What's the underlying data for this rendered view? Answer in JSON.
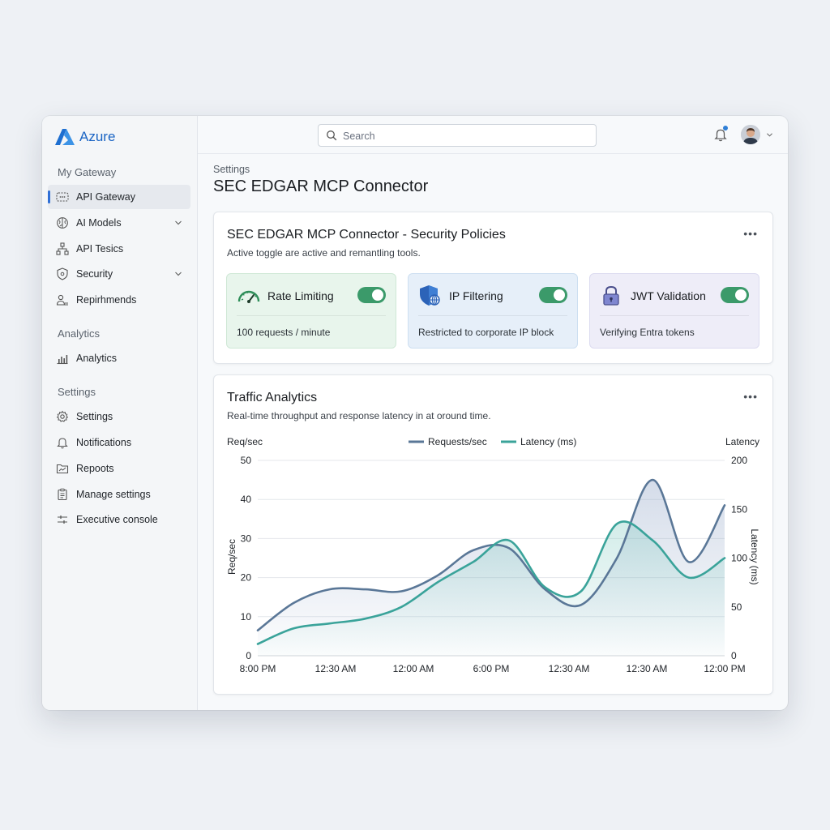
{
  "app": {
    "brand": "Azure"
  },
  "sidebar": {
    "sections": [
      {
        "label": "My Gateway"
      },
      {
        "label": "Analytics"
      },
      {
        "label": "Settings"
      }
    ],
    "items": [
      {
        "label": "API Gateway",
        "icon": "api-gateway-icon",
        "active": true
      },
      {
        "label": "AI Models",
        "icon": "brain-icon",
        "chevron": true
      },
      {
        "label": "API Tesics",
        "icon": "hierarchy-icon"
      },
      {
        "label": "Security",
        "icon": "shield-icon",
        "chevron": true
      },
      {
        "label": "Repirhmends",
        "icon": "user-list-icon"
      },
      {
        "label": "Analytics",
        "icon": "bar-chart-icon"
      },
      {
        "label": "Settings",
        "icon": "gear-icon"
      },
      {
        "label": "Notifications",
        "icon": "bell-icon"
      },
      {
        "label": "Repoots",
        "icon": "folder-chart-icon"
      },
      {
        "label": "Manage settings",
        "icon": "clipboard-icon"
      },
      {
        "label": "Executive console",
        "icon": "sliders-icon"
      }
    ]
  },
  "topbar": {
    "search_placeholder": "Search"
  },
  "page": {
    "breadcrumb": "Settings",
    "title": "SEC EDGAR MCP Connector"
  },
  "policies_card": {
    "title": "SEC EDGAR MCP Connector - Security Policies",
    "subtitle": "Active toggle are active and remantling tools.",
    "more": "•••",
    "policies": [
      {
        "name": "Rate Limiting",
        "desc": "100 requests / minute",
        "icon": "speedometer-icon",
        "enabled": true,
        "bg": "#e8f5ec",
        "border": "#cfe8d6"
      },
      {
        "name": "IP Filtering",
        "desc": "Restricted to corporate IP block",
        "icon": "shield-globe-icon",
        "enabled": true,
        "bg": "#e6eff9",
        "border": "#cddff1"
      },
      {
        "name": "JWT Validation",
        "desc": "Verifying Entra tokens",
        "icon": "lock-icon",
        "enabled": true,
        "bg": "#eeedf8",
        "border": "#dcdbf0"
      }
    ],
    "toggle_color": "#3b9a6a"
  },
  "traffic_card": {
    "title": "Traffic Analytics",
    "subtitle": "Real-time throughput and response latency in at oround time.",
    "more": "•••"
  },
  "chart_data": {
    "type": "line",
    "x": [
      "8:00 PM",
      "12:30 AM",
      "12:00 AM",
      "6:00 PM",
      "12:30 AM",
      "12:30 AM",
      "12:00 PM"
    ],
    "series": [
      {
        "name": "Requests/sec",
        "axis": "left",
        "color": "#5a7797",
        "values": [
          6.5,
          13.5,
          17,
          17,
          16.5,
          20.5,
          27,
          27.5,
          17,
          13,
          25,
          45,
          24,
          38.5
        ]
      },
      {
        "name": "Latency (ms)",
        "axis": "right",
        "color": "#3aa39a",
        "values": [
          12,
          28,
          33,
          38,
          50,
          75,
          96,
          118,
          70,
          66,
          135,
          118,
          80,
          100
        ]
      }
    ],
    "title": "Traffic Analytics",
    "ylabel": "Req/sec",
    "ylabel_top": "Req/sec",
    "y2label": "Latency (ms)",
    "y2label_top": "Latency",
    "ylim": [
      0,
      50
    ],
    "y2lim": [
      0,
      200
    ],
    "yticks": [
      0,
      10,
      20,
      30,
      40,
      50
    ],
    "y2ticks": [
      0,
      50,
      100,
      150,
      200
    ],
    "grid": true,
    "legend": "top-center"
  }
}
